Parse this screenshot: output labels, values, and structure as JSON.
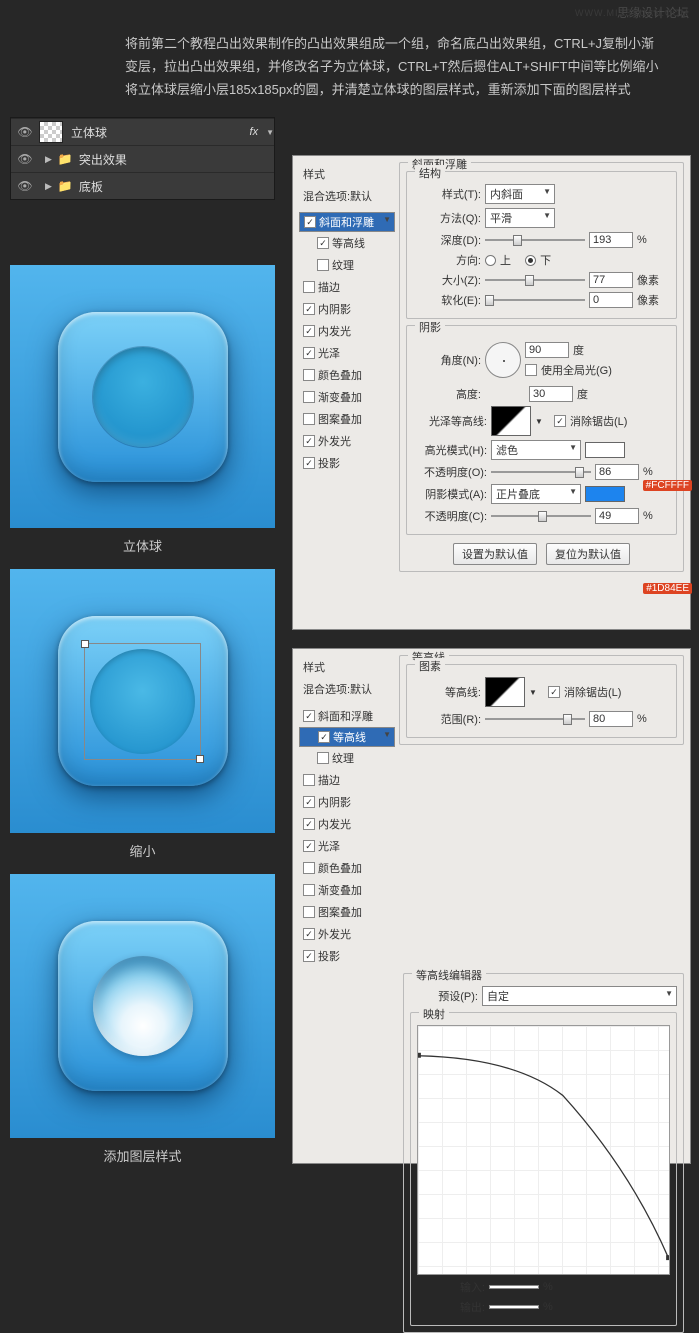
{
  "watermark": {
    "site": "思缘设计论坛",
    "url": "WWW.MISSYUAN.COM"
  },
  "intro": "将前第二个教程凸出效果制作的凸出效果组成一个组，命名底凸出效果组，CTRL+J复制小渐变层，拉出凸出效果组，并修改名子为立体球，CTRL+T然后摁住ALT+SHIFT中间等比例缩小将立体球层缩小层185x185px的圆，并清楚立体球的图层样式，重新添加下面的图层样式",
  "layers": {
    "l1": "立体球",
    "l2": "突出效果",
    "l3": "底板",
    "fx": "fx"
  },
  "captions": {
    "c1": "立体球",
    "c2": "缩小",
    "c3": "添加图层样式"
  },
  "p1": {
    "styleHdr": "样式",
    "defHdr": "混合选项:默认",
    "items": [
      "斜面和浮雕",
      "等高线",
      "纹理",
      "描边",
      "内阴影",
      "内发光",
      "光泽",
      "颜色叠加",
      "渐变叠加",
      "图案叠加",
      "外发光",
      "投影"
    ],
    "bevel": {
      "title": "斜面和浮雕",
      "struct": "结构",
      "styleLbl": "样式(T):",
      "styleVal": "内斜面",
      "methodLbl": "方法(Q):",
      "methodVal": "平滑",
      "depthLbl": "深度(D):",
      "depthVal": "193",
      "pct": "%",
      "dirLbl": "方向:",
      "up": "上",
      "down": "下",
      "sizeLbl": "大小(Z):",
      "sizeVal": "77",
      "px": "像素",
      "softLbl": "软化(E):",
      "softVal": "0"
    },
    "shadow": {
      "title": "阴影",
      "angleLbl": "角度(N):",
      "angleVal": "90",
      "deg": "度",
      "globalLbl": "使用全局光(G)",
      "altLbl": "高度:",
      "altVal": "30",
      "glossLbl": "光泽等高线:",
      "aaLbl": "消除锯齿(L)",
      "hiLbl": "高光模式(H):",
      "hiVal": "滤色",
      "opLbl": "不透明度(O):",
      "opVal": "86",
      "shLbl": "阴影模式(A):",
      "shVal": "正片叠底",
      "op2Lbl": "不透明度(C):",
      "op2Val": "49"
    },
    "btns": {
      "def": "设置为默认值",
      "reset": "复位为默认值"
    },
    "tags": {
      "t1": "#FCFFFF",
      "t2": "#1D84EE"
    }
  },
  "p2": {
    "styleHdr": "样式",
    "defHdr": "混合选项:默认",
    "contour": {
      "title": "等高线",
      "element": "图素",
      "cLbl": "等高线:",
      "aaLbl": "消除锯齿(L)",
      "rangeLbl": "范围(R):",
      "rangeVal": "80",
      "pct": "%"
    },
    "editor": {
      "title": "等高线编辑器",
      "presetLbl": "预设(P):",
      "presetVal": "自定",
      "mapping": "映射",
      "inLbl": "输入:",
      "outLbl": "输出:",
      "pct": "%"
    }
  }
}
